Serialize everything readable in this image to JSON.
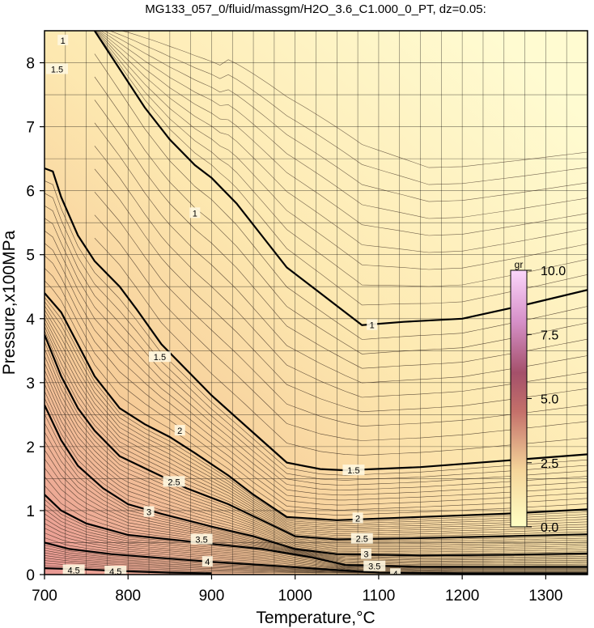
{
  "chart_data": {
    "type": "contour",
    "title": "MG133_057_0/fluid/massgm/H2O_3.6_C1.000_0_PT, dz=0.05:",
    "xlabel": "Temperature,°C",
    "ylabel": "Pressure,x100MPa",
    "xlim": [
      700,
      1350
    ],
    "ylim": [
      0,
      8.5
    ],
    "grid": true,
    "xticks": [
      "700",
      "800",
      "900",
      "1000",
      "1100",
      "1200",
      "1300"
    ],
    "yticks": [
      "0",
      "1",
      "2",
      "3",
      "4",
      "5",
      "6",
      "7",
      "8"
    ],
    "contour_interval": 0.05,
    "major_contours": [
      {
        "label": "1",
        "points": [
          [
            760,
            8.5
          ],
          [
            790,
            7.9
          ],
          [
            820,
            7.3
          ],
          [
            850,
            6.8
          ],
          [
            880,
            6.4
          ],
          [
            900,
            6.2
          ],
          [
            930,
            5.8
          ],
          [
            960,
            5.3
          ],
          [
            990,
            4.8
          ],
          [
            1030,
            4.4
          ],
          [
            1060,
            4.1
          ],
          [
            1080,
            3.9
          ],
          [
            1130,
            3.95
          ],
          [
            1200,
            4.0
          ],
          [
            1270,
            4.2
          ],
          [
            1350,
            4.45
          ]
        ]
      },
      {
        "label": "1.5",
        "points": [
          [
            700,
            6.35
          ],
          [
            710,
            6.3
          ],
          [
            720,
            5.9
          ],
          [
            740,
            5.3
          ],
          [
            760,
            4.9
          ],
          [
            790,
            4.5
          ],
          [
            810,
            4.15
          ],
          [
            840,
            3.6
          ],
          [
            870,
            3.2
          ],
          [
            900,
            2.8
          ],
          [
            930,
            2.45
          ],
          [
            960,
            2.1
          ],
          [
            990,
            1.75
          ],
          [
            1030,
            1.65
          ],
          [
            1060,
            1.63
          ],
          [
            1150,
            1.68
          ],
          [
            1250,
            1.78
          ],
          [
            1350,
            1.88
          ]
        ]
      },
      {
        "label": "2",
        "points": [
          [
            700,
            4.4
          ],
          [
            720,
            4.1
          ],
          [
            740,
            3.6
          ],
          [
            760,
            3.1
          ],
          [
            790,
            2.6
          ],
          [
            820,
            2.35
          ],
          [
            850,
            2.15
          ],
          [
            880,
            1.9
          ],
          [
            920,
            1.55
          ],
          [
            950,
            1.25
          ],
          [
            990,
            0.9
          ],
          [
            1050,
            0.85
          ],
          [
            1150,
            0.9
          ],
          [
            1250,
            0.95
          ],
          [
            1350,
            1.02
          ]
        ]
      },
      {
        "label": "2.5",
        "points": [
          [
            700,
            3.75
          ],
          [
            720,
            3.1
          ],
          [
            740,
            2.6
          ],
          [
            760,
            2.25
          ],
          [
            790,
            1.85
          ],
          [
            830,
            1.6
          ],
          [
            870,
            1.35
          ],
          [
            920,
            1.1
          ],
          [
            960,
            0.85
          ],
          [
            1000,
            0.6
          ],
          [
            1050,
            0.55
          ],
          [
            1150,
            0.57
          ],
          [
            1250,
            0.6
          ],
          [
            1350,
            0.63
          ]
        ]
      },
      {
        "label": "3",
        "points": [
          [
            700,
            2.65
          ],
          [
            720,
            2.1
          ],
          [
            740,
            1.7
          ],
          [
            770,
            1.35
          ],
          [
            800,
            1.1
          ],
          [
            840,
            0.95
          ],
          [
            900,
            0.75
          ],
          [
            950,
            0.6
          ],
          [
            1000,
            0.4
          ],
          [
            1050,
            0.32
          ],
          [
            1150,
            0.3
          ],
          [
            1250,
            0.31
          ],
          [
            1350,
            0.33
          ]
        ]
      },
      {
        "label": "3.5",
        "points": [
          [
            700,
            1.25
          ],
          [
            720,
            1.0
          ],
          [
            750,
            0.8
          ],
          [
            800,
            0.62
          ],
          [
            850,
            0.55
          ],
          [
            900,
            0.48
          ],
          [
            960,
            0.4
          ],
          [
            1020,
            0.27
          ],
          [
            1060,
            0.15
          ],
          [
            1150,
            0.12
          ],
          [
            1250,
            0.12
          ],
          [
            1350,
            0.12
          ]
        ]
      },
      {
        "label": "4",
        "points": [
          [
            700,
            0.5
          ],
          [
            730,
            0.4
          ],
          [
            780,
            0.32
          ],
          [
            830,
            0.27
          ],
          [
            900,
            0.2
          ],
          [
            960,
            0.15
          ],
          [
            1040,
            0.08
          ],
          [
            1100,
            0.03
          ],
          [
            1200,
            0.02
          ],
          [
            1350,
            0.02
          ]
        ]
      },
      {
        "label": "4.5",
        "points": [
          [
            700,
            0.1
          ],
          [
            750,
            0.08
          ],
          [
            800,
            0.05
          ],
          [
            850,
            0.03
          ],
          [
            900,
            0.02
          ]
        ]
      }
    ],
    "contour_labels": [
      {
        "text": "1",
        "x": 880,
        "y": 5.65
      },
      {
        "text": "1",
        "x": 1092,
        "y": 3.9
      },
      {
        "text": "1.5",
        "x": 838,
        "y": 3.4
      },
      {
        "text": "1.5",
        "x": 1070,
        "y": 1.63
      },
      {
        "text": "2",
        "x": 862,
        "y": 2.25
      },
      {
        "text": "2",
        "x": 1075,
        "y": 0.88
      },
      {
        "text": "2.5",
        "x": 855,
        "y": 1.45
      },
      {
        "text": "2.5",
        "x": 1080,
        "y": 0.56
      },
      {
        "text": "3",
        "x": 825,
        "y": 0.98
      },
      {
        "text": "3",
        "x": 1085,
        "y": 0.32
      },
      {
        "text": "3.5",
        "x": 888,
        "y": 0.55
      },
      {
        "text": "3.5",
        "x": 1095,
        "y": 0.13
      },
      {
        "text": "4",
        "x": 895,
        "y": 0.2
      },
      {
        "text": "4",
        "x": 1120,
        "y": 0.01
      },
      {
        "text": "4.5",
        "x": 735,
        "y": 0.07
      },
      {
        "text": "4.5",
        "x": 785,
        "y": 0.05
      },
      {
        "text": "1",
        "x": 722,
        "y": 8.35
      },
      {
        "text": "1.5",
        "x": 715,
        "y": 7.9
      }
    ],
    "colorbar": {
      "label": "gr",
      "ticks": [
        "0.0",
        "2.5",
        "5.0",
        "7.5",
        "10.0"
      ],
      "range": [
        0,
        10
      ]
    },
    "colors": {
      "low": "#fffccd",
      "mid": "#f8d49b",
      "high": "#e38f8f",
      "max": "#f4b8f0"
    }
  }
}
